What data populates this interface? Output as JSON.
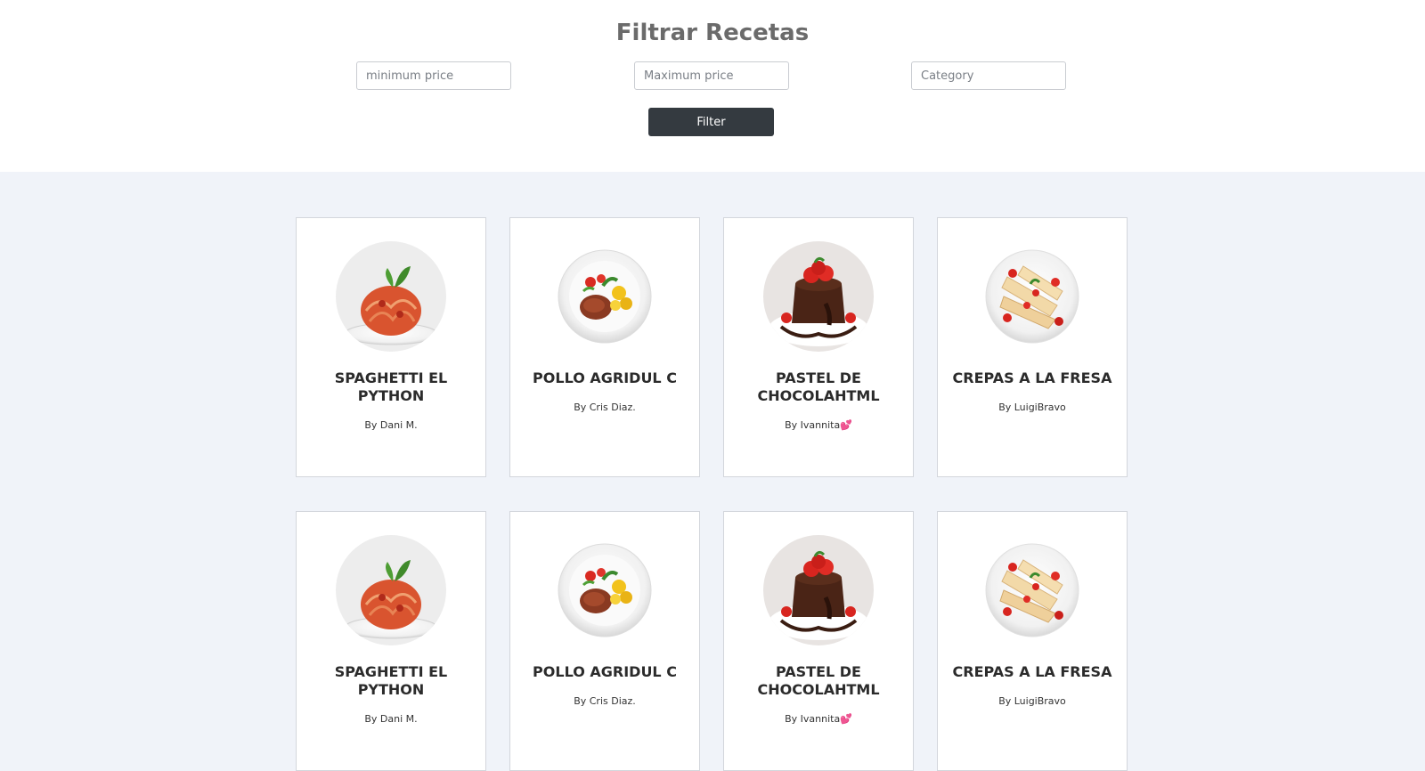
{
  "filter": {
    "title": "Filtrar Recetas",
    "min_price_placeholder": "minimum price",
    "max_price_placeholder": "Maximum price",
    "category_placeholder": "Category",
    "button_label": "Filter"
  },
  "recipes": [
    {
      "title": "SPAGHETTI EL PYTHON",
      "author": "By Dani M.",
      "image": "spaghetti-image"
    },
    {
      "title": "POLLO AGRIDUL C",
      "author": "By Cris Diaz.",
      "image": "chicken-plate-image"
    },
    {
      "title": "PASTEL DE CHOCOLAHTML",
      "author": "By Ivannita💕",
      "image": "chocolate-cake-image"
    },
    {
      "title": "CREPAS A LA FRESA",
      "author": "By LuigiBravo",
      "image": "strawberry-crepes-image"
    },
    {
      "title": "SPAGHETTI EL PYTHON",
      "author": "By Dani M.",
      "image": "spaghetti-image"
    },
    {
      "title": "POLLO AGRIDUL C",
      "author": "By Cris Diaz.",
      "image": "chicken-plate-image"
    },
    {
      "title": "PASTEL DE CHOCOLAHTML",
      "author": "By Ivannita💕",
      "image": "chocolate-cake-image"
    },
    {
      "title": "CREPAS A LA FRESA",
      "author": "By LuigiBravo",
      "image": "strawberry-crepes-image"
    }
  ],
  "colors": {
    "page_background": "#f0f3f9",
    "button": "#343a40",
    "title": "#6b6b6b"
  }
}
